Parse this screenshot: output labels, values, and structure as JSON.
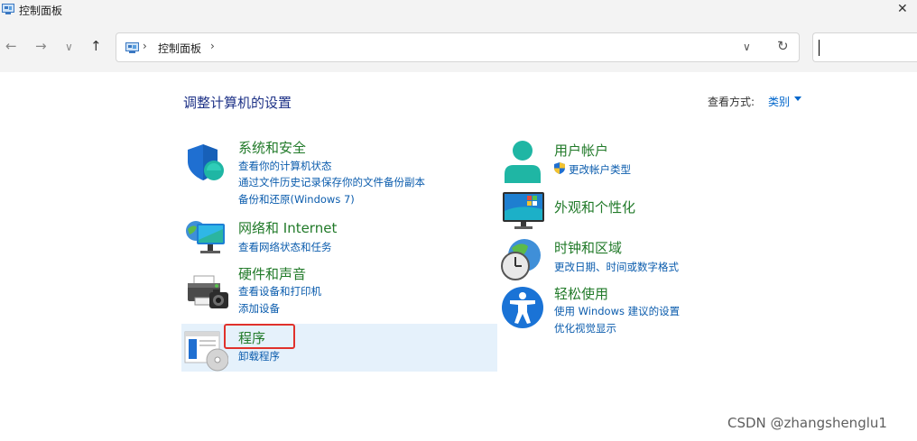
{
  "window": {
    "title": "控制面板",
    "close_glyph": "✕"
  },
  "nav": {
    "back_glyph": "←",
    "forward_glyph": "→",
    "history_glyph": "∨",
    "up_glyph": "↑",
    "breadcrumb_sep": "›",
    "breadcrumb": "控制面板",
    "dropdown_glyph": "∨",
    "refresh_glyph": "↻"
  },
  "header": {
    "title": "调整计算机的设置",
    "view_by_label": "查看方式:",
    "view_by_value": "类别"
  },
  "left_categories": [
    {
      "title": "系统和安全",
      "links": [
        "查看你的计算机状态",
        "通过文件历史记录保存你的文件备份副本",
        "备份和还原(Windows 7)"
      ]
    },
    {
      "title": "网络和 Internet",
      "links": [
        "查看网络状态和任务"
      ]
    },
    {
      "title": "硬件和声音",
      "links": [
        "查看设备和打印机",
        "添加设备"
      ]
    },
    {
      "title": "程序",
      "links": [
        "卸载程序"
      ]
    }
  ],
  "right_categories": [
    {
      "title": "用户帐户",
      "links": [
        "更改帐户类型"
      ]
    },
    {
      "title": "外观和个性化",
      "links": []
    },
    {
      "title": "时钟和区域",
      "links": [
        "更改日期、时间或数字格式"
      ]
    },
    {
      "title": "轻松使用",
      "links": [
        "使用 Windows 建议的设置",
        "优化视觉显示"
      ]
    }
  ],
  "watermark": "CSDN @zhangshenglu1"
}
